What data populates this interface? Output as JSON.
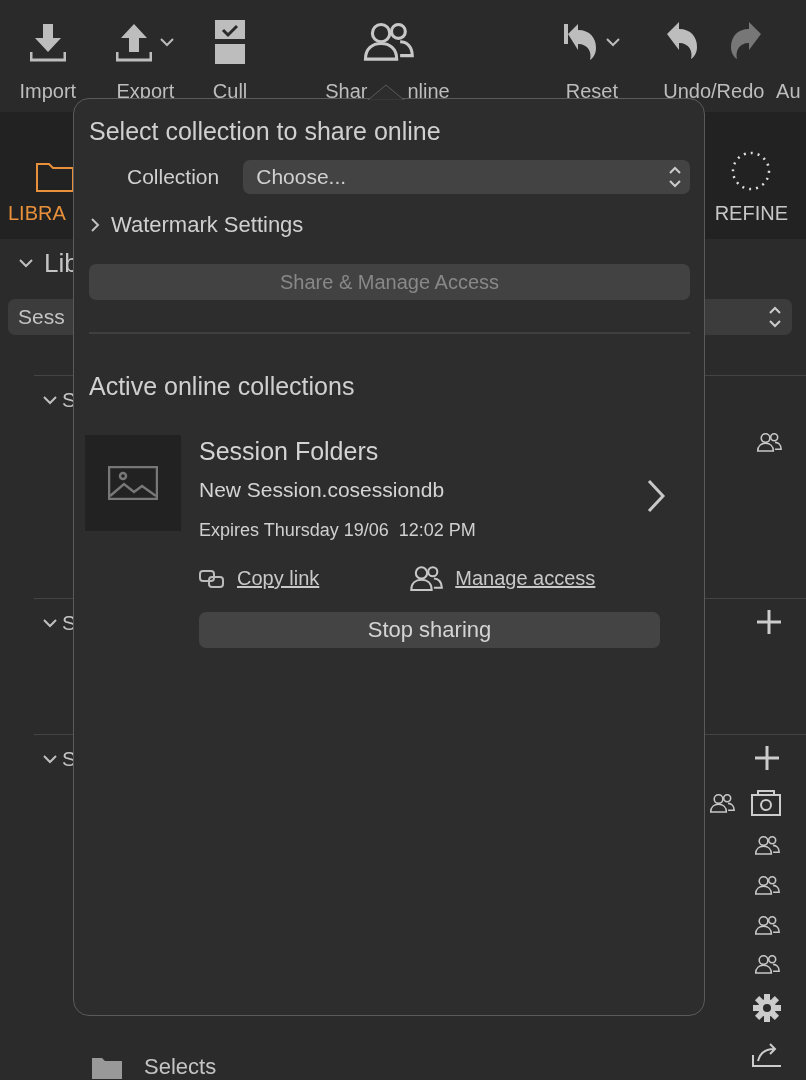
{
  "toolbar": {
    "import": "Import",
    "export": "Export",
    "cull": "Cull",
    "share_left": "Shar",
    "share_right": "nline",
    "reset": "Reset",
    "undo_redo": "Undo/Redo",
    "cut_item": "Au"
  },
  "tabs": [
    {
      "label": "LIBRA",
      "selected": true
    },
    {
      "label": "REFINE",
      "selected": false
    }
  ],
  "library": {
    "header": "Lib",
    "expanded": true,
    "source": "Sess"
  },
  "sections": [
    {
      "label": "S",
      "expanded": true
    },
    {
      "label": "S",
      "expanded": true
    },
    {
      "label": "S",
      "expanded": true
    }
  ],
  "folders": [
    {
      "name": "Selects"
    }
  ],
  "popover": {
    "title": "Select collection to share online",
    "collection_label": "Collection",
    "collection_value": "Choose...",
    "watermark": {
      "label": "Watermark Settings",
      "expanded": false
    },
    "share_button": {
      "label": "Share & Manage Access",
      "disabled": true
    },
    "active_heading": "Active online collections",
    "collections": [
      {
        "title": "Session Folders",
        "file": "New Session.cosessiondb",
        "expires": "Expires Thursday 19/06  12:02 PM",
        "copy_link": "Copy link",
        "manage_access": "Manage access",
        "stop": "Stop sharing"
      }
    ]
  }
}
